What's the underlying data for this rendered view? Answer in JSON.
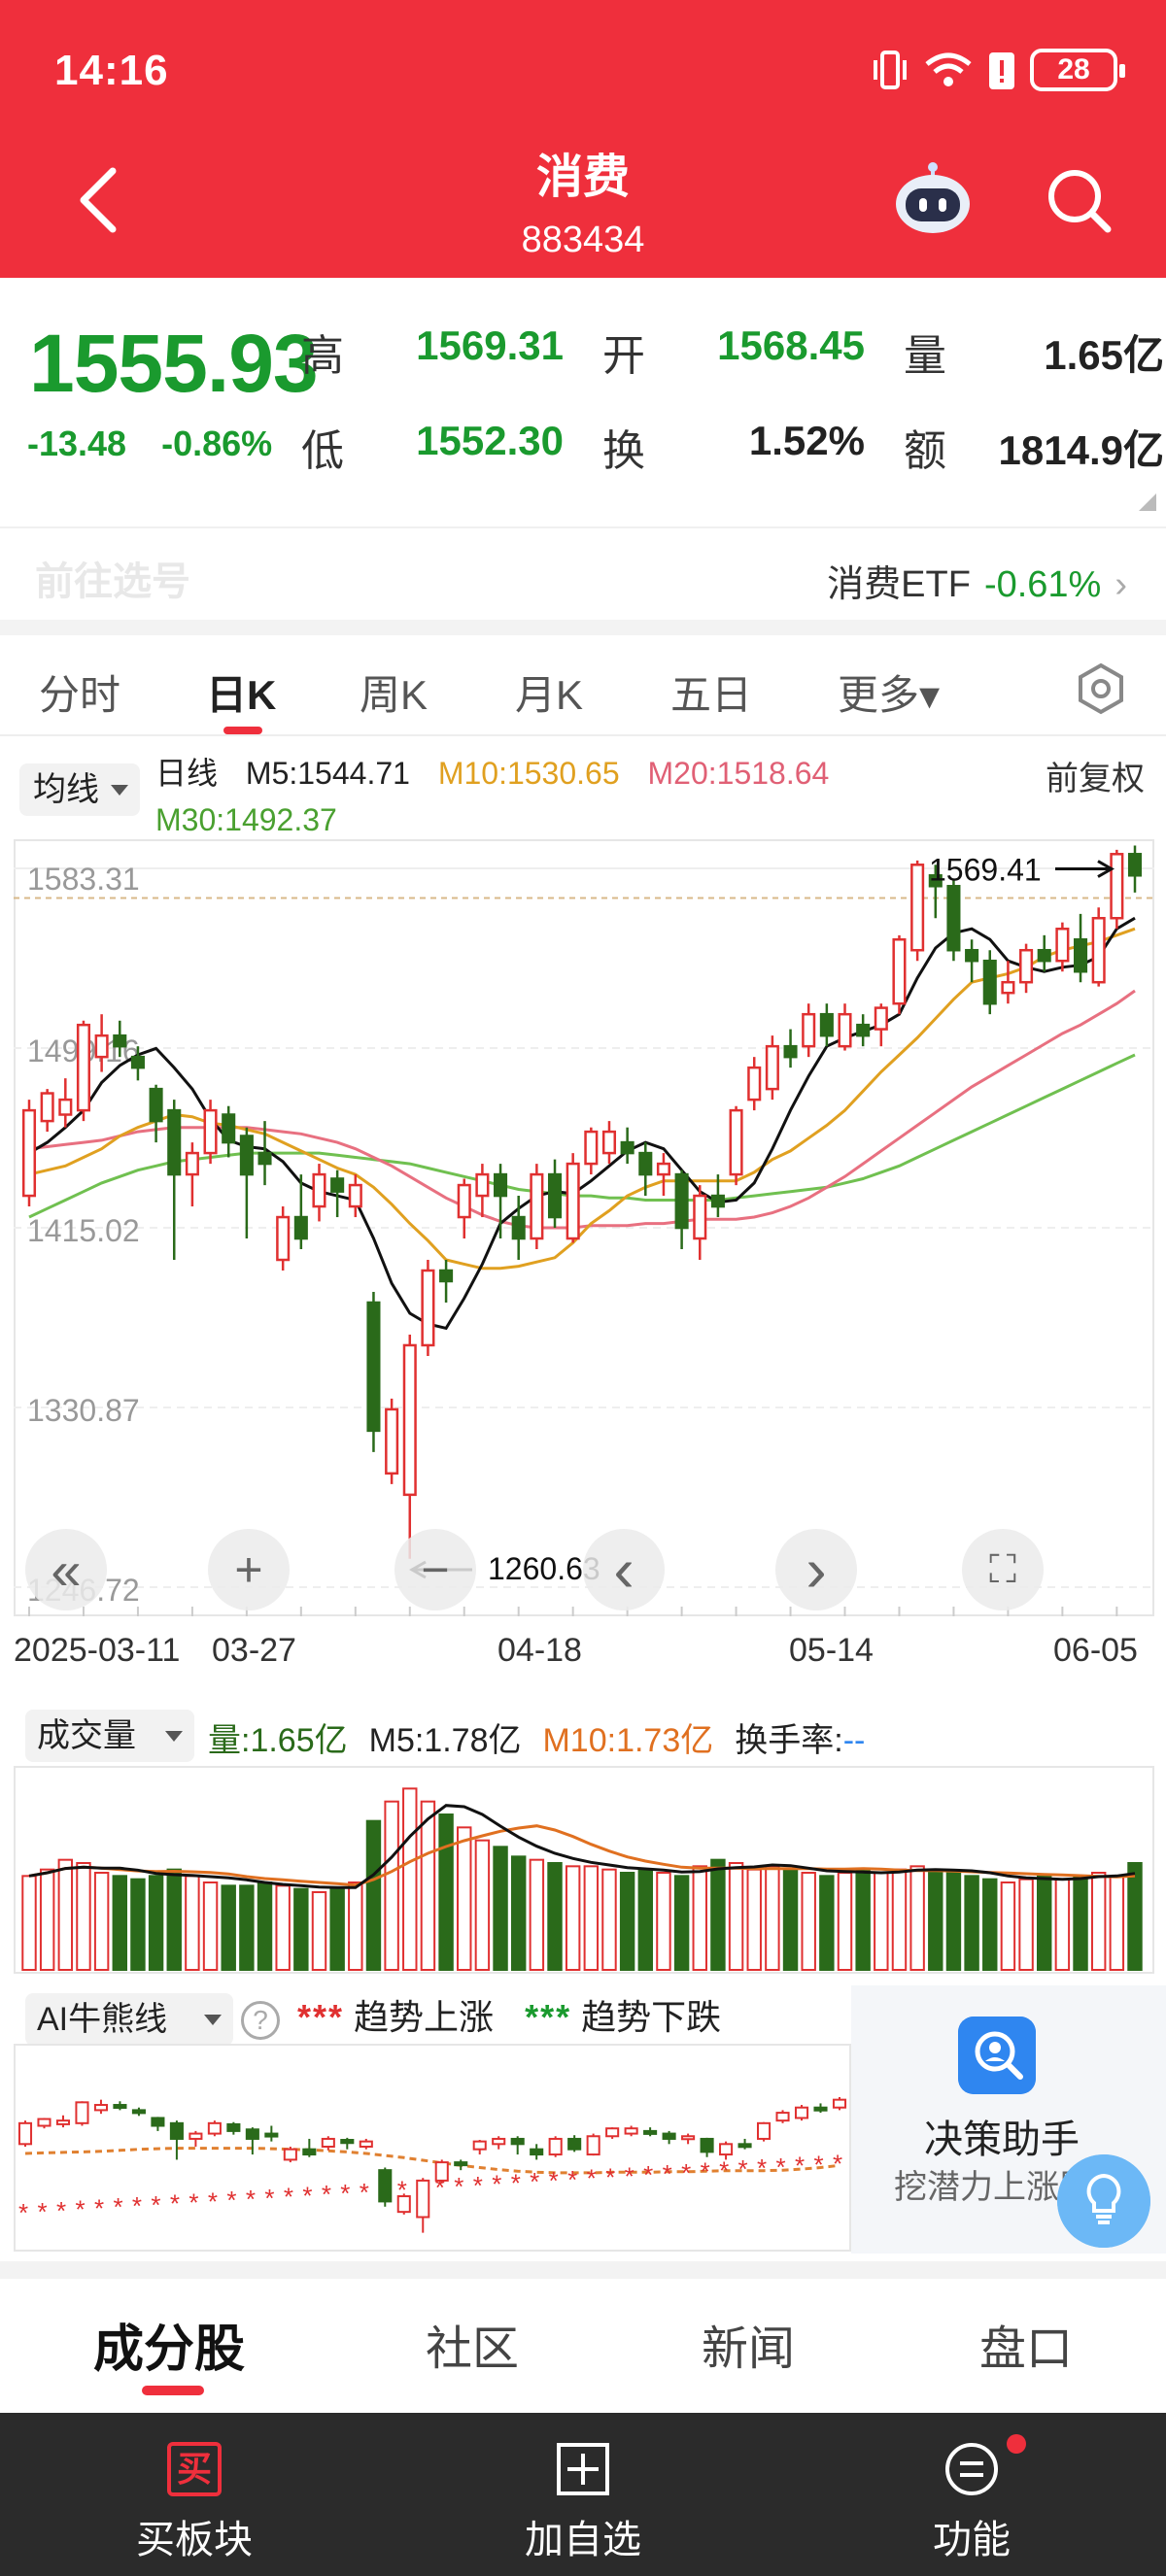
{
  "status_bar": {
    "time": "14:16",
    "battery": "28"
  },
  "header": {
    "title": "消费",
    "code": "883434"
  },
  "quote": {
    "price": "1555.93",
    "change": "-13.48",
    "change_pct": "-0.86%",
    "fields": [
      {
        "label": "高",
        "value": "1569.31"
      },
      {
        "label": "开",
        "value": "1568.45"
      },
      {
        "label": "量",
        "value": "1.65亿"
      },
      {
        "label": "低",
        "value": "1552.30"
      },
      {
        "label": "换",
        "value": "1.52%"
      },
      {
        "label": "额",
        "value": "1814.9亿"
      }
    ]
  },
  "etf": {
    "name": "消费ETF",
    "pct": "-0.61%",
    "faded_text": "前往选号"
  },
  "period_tabs": [
    "分时",
    "日K",
    "周K",
    "月K",
    "五日",
    "更多▾"
  ],
  "active_period": "日K",
  "ma": {
    "selector": "均线",
    "line_label": "日线",
    "m5": "M5:1544.71",
    "m10": "M10:1530.65",
    "m20": "M20:1518.64",
    "m30": "M30:1492.37",
    "adjust": "前复权"
  },
  "colors": {
    "up": "#e03030",
    "down": "#2a6a1a",
    "m5": "#111111",
    "m10": "#e0a020",
    "m20": "#e87080",
    "m30": "#70c050",
    "header": "#ef2f3c"
  },
  "chart_data": {
    "type": "candlestick",
    "ylim": [
      1246.72,
      1583.31
    ],
    "y_ticks": [
      "1583.31",
      "1499.16",
      "1415.02",
      "1330.87",
      "1246.72"
    ],
    "x_ticks": [
      "2025-03-11",
      "03-27",
      "04-18",
      "05-14",
      "06-05"
    ],
    "high_marker": "1569.41",
    "low_marker": "1260.63",
    "candles": [
      [
        1430,
        1470,
        1425,
        1475
      ],
      [
        1465,
        1478,
        1460,
        1480
      ],
      [
        1468,
        1475,
        1462,
        1485
      ],
      [
        1470,
        1510,
        1465,
        1512
      ],
      [
        1495,
        1505,
        1488,
        1515
      ],
      [
        1505,
        1500,
        1495,
        1512
      ],
      [
        1495,
        1490,
        1484,
        1500
      ],
      [
        1480,
        1465,
        1455,
        1482
      ],
      [
        1470,
        1440,
        1400,
        1475
      ],
      [
        1440,
        1450,
        1425,
        1455
      ],
      [
        1450,
        1470,
        1445,
        1475
      ],
      [
        1468,
        1455,
        1448,
        1472
      ],
      [
        1458,
        1440,
        1410,
        1462
      ],
      [
        1450,
        1445,
        1435,
        1465
      ],
      [
        1400,
        1420,
        1395,
        1425
      ],
      [
        1420,
        1410,
        1405,
        1440
      ],
      [
        1425,
        1440,
        1418,
        1445
      ],
      [
        1438,
        1432,
        1420,
        1442
      ],
      [
        1425,
        1435,
        1420,
        1440
      ],
      [
        1380,
        1320,
        1310,
        1385
      ],
      [
        1300,
        1330,
        1295,
        1335
      ],
      [
        1290,
        1360,
        1260,
        1365
      ],
      [
        1360,
        1395,
        1355,
        1400
      ],
      [
        1395,
        1390,
        1380,
        1400
      ],
      [
        1420,
        1435,
        1410,
        1438
      ],
      [
        1430,
        1440,
        1420,
        1445
      ],
      [
        1440,
        1430,
        1410,
        1445
      ],
      [
        1420,
        1410,
        1400,
        1430
      ],
      [
        1410,
        1440,
        1405,
        1445
      ],
      [
        1440,
        1420,
        1415,
        1447
      ],
      [
        1410,
        1445,
        1408,
        1450
      ],
      [
        1445,
        1460,
        1440,
        1462
      ],
      [
        1450,
        1460,
        1445,
        1465
      ],
      [
        1455,
        1450,
        1445,
        1462
      ],
      [
        1450,
        1440,
        1430,
        1455
      ],
      [
        1440,
        1445,
        1430,
        1450
      ],
      [
        1440,
        1415,
        1405,
        1442
      ],
      [
        1410,
        1430,
        1400,
        1435
      ],
      [
        1430,
        1425,
        1420,
        1440
      ],
      [
        1440,
        1470,
        1435,
        1472
      ],
      [
        1475,
        1490,
        1470,
        1495
      ],
      [
        1480,
        1500,
        1475,
        1505
      ],
      [
        1500,
        1495,
        1490,
        1508
      ],
      [
        1500,
        1515,
        1495,
        1520
      ],
      [
        1515,
        1505,
        1500,
        1520
      ],
      [
        1500,
        1515,
        1498,
        1520
      ],
      [
        1510,
        1505,
        1500,
        1515
      ],
      [
        1508,
        1518,
        1500,
        1520
      ],
      [
        1520,
        1550,
        1515,
        1552
      ],
      [
        1545,
        1585,
        1540,
        1587
      ],
      [
        1580,
        1575,
        1560,
        1585
      ],
      [
        1575,
        1545,
        1540,
        1578
      ],
      [
        1545,
        1540,
        1530,
        1550
      ],
      [
        1540,
        1520,
        1515,
        1545
      ],
      [
        1525,
        1530,
        1520,
        1540
      ],
      [
        1530,
        1545,
        1525,
        1548
      ],
      [
        1545,
        1540,
        1535,
        1552
      ],
      [
        1540,
        1555,
        1535,
        1558
      ],
      [
        1550,
        1535,
        1530,
        1562
      ],
      [
        1530,
        1560,
        1528,
        1565
      ],
      [
        1560,
        1590,
        1555,
        1592
      ],
      [
        1590,
        1580,
        1572,
        1594
      ]
    ],
    "ma5": [
      1450,
      1455,
      1462,
      1470,
      1483,
      1491,
      1496,
      1499,
      1490,
      1480,
      1466,
      1456,
      1453,
      1452,
      1446,
      1436,
      1432,
      1430,
      1428,
      1410,
      1389,
      1375,
      1370,
      1368,
      1382,
      1398,
      1417,
      1424,
      1430,
      1432,
      1431,
      1437,
      1444,
      1451,
      1455,
      1452,
      1442,
      1432,
      1427,
      1428,
      1436,
      1452,
      1470,
      1486,
      1500,
      1504,
      1507,
      1510,
      1515,
      1532,
      1546,
      1553,
      1555,
      1550,
      1540,
      1537,
      1535,
      1537,
      1538,
      1542,
      1555,
      1560
    ],
    "ma10": [
      1440,
      1442,
      1444,
      1448,
      1452,
      1458,
      1462,
      1465,
      1468,
      1467,
      1464,
      1463,
      1461,
      1459,
      1455,
      1451,
      1447,
      1443,
      1440,
      1434,
      1426,
      1417,
      1409,
      1400,
      1398,
      1396,
      1396,
      1397,
      1399,
      1401,
      1408,
      1417,
      1423,
      1430,
      1434,
      1437,
      1437,
      1437,
      1437,
      1437,
      1441,
      1447,
      1451,
      1457,
      1463,
      1470,
      1479,
      1488,
      1496,
      1504,
      1513,
      1522,
      1530,
      1532,
      1534,
      1537,
      1542,
      1545,
      1547,
      1549,
      1552,
      1555
    ],
    "ma20": [
      1452,
      1453,
      1454,
      1455,
      1456,
      1458,
      1460,
      1461,
      1462,
      1462,
      1462,
      1462,
      1462,
      1461,
      1460,
      1459,
      1457,
      1455,
      1452,
      1448,
      1444,
      1439,
      1434,
      1429,
      1425,
      1421,
      1418,
      1416,
      1415,
      1415,
      1415,
      1416,
      1416,
      1416,
      1417,
      1417,
      1418,
      1419,
      1419,
      1419,
      1420,
      1422,
      1425,
      1429,
      1434,
      1439,
      1445,
      1451,
      1457,
      1463,
      1469,
      1475,
      1481,
      1486,
      1491,
      1496,
      1501,
      1506,
      1510,
      1515,
      1520,
      1526
    ],
    "ma30": [
      1420,
      1424,
      1428,
      1432,
      1436,
      1439,
      1442,
      1444,
      1446,
      1447,
      1448,
      1449,
      1450,
      1450,
      1450,
      1450,
      1450,
      1449,
      1448,
      1447,
      1446,
      1445,
      1443,
      1441,
      1439,
      1437,
      1435,
      1433,
      1432,
      1431,
      1430,
      1430,
      1429,
      1429,
      1428,
      1428,
      1428,
      1428,
      1428,
      1429,
      1430,
      1431,
      1432,
      1433,
      1434,
      1436,
      1438,
      1441,
      1444,
      1448,
      1452,
      1456,
      1460,
      1464,
      1468,
      1472,
      1476,
      1480,
      1484,
      1488,
      1492,
      1496
    ]
  },
  "controls": {
    "first": "«",
    "zoom_in": "+",
    "zoom_out": "−",
    "prev": "‹",
    "next": "›",
    "fullscreen": "⛶"
  },
  "volume": {
    "selector": "成交量",
    "vol": "量:1.65亿",
    "m5": "M5:1.78亿",
    "m10": "M10:1.73亿",
    "turnover_label": "换手率:",
    "turnover_value": "--",
    "bars": [
      1.45,
      1.55,
      1.7,
      1.65,
      1.5,
      1.45,
      1.4,
      1.45,
      1.55,
      1.45,
      1.35,
      1.3,
      1.3,
      1.35,
      1.3,
      1.25,
      1.2,
      1.25,
      1.35,
      2.3,
      2.6,
      2.8,
      2.6,
      2.4,
      2.2,
      2.0,
      1.9,
      1.75,
      1.7,
      1.65,
      1.6,
      1.6,
      1.55,
      1.5,
      1.55,
      1.5,
      1.45,
      1.6,
      1.7,
      1.65,
      1.55,
      1.6,
      1.55,
      1.5,
      1.45,
      1.5,
      1.55,
      1.5,
      1.55,
      1.6,
      1.55,
      1.5,
      1.45,
      1.4,
      1.35,
      1.4,
      1.45,
      1.4,
      1.45,
      1.5,
      1.45,
      1.65
    ]
  },
  "ai": {
    "selector": "AI牛熊线",
    "help": "?",
    "up_marker": "***",
    "up_label": "趋势上涨",
    "down_marker": "***",
    "down_label": "趋势下跌"
  },
  "helper": {
    "title": "决策助手",
    "subtitle": "挖潜力上涨股"
  },
  "bottom_tabs": [
    "成分股",
    "社区",
    "新闻",
    "盘口"
  ],
  "actions": [
    {
      "icon": "buy-icon",
      "label": "买板块",
      "glyph": "买"
    },
    {
      "icon": "add-watchlist-icon",
      "label": "加自选"
    },
    {
      "icon": "menu-icon",
      "label": "功能"
    }
  ]
}
